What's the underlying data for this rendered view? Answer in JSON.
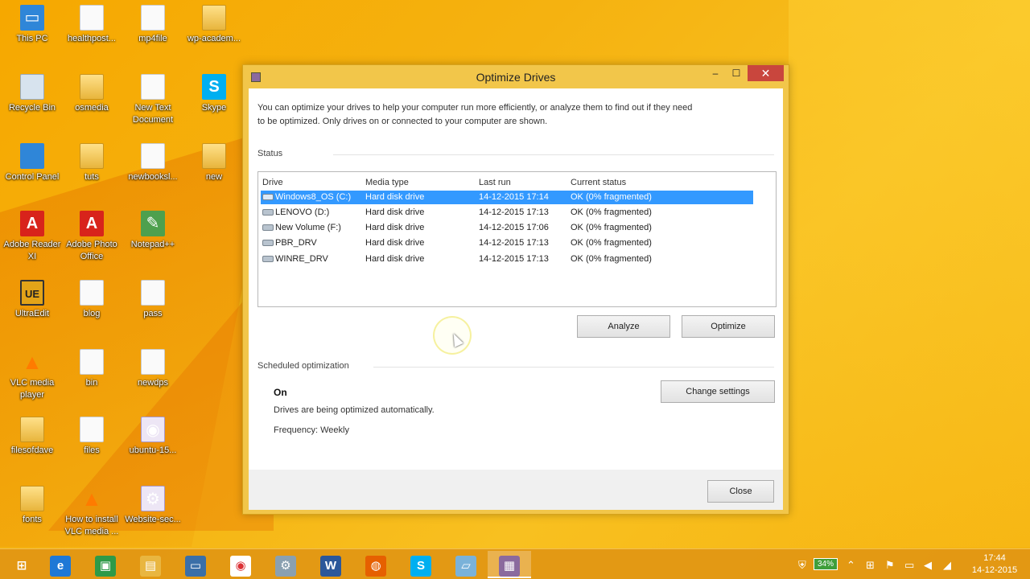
{
  "desktop": {
    "icons": [
      {
        "label": "This PC",
        "glyph": "▭",
        "kind": "pc"
      },
      {
        "label": "healthpost...",
        "glyph": "",
        "kind": "doc"
      },
      {
        "label": "mp4file",
        "glyph": "",
        "kind": "doc"
      },
      {
        "label": "wp-academ...",
        "glyph": "",
        "kind": "folder"
      },
      {
        "label": "Recycle Bin",
        "glyph": "",
        "kind": "bin"
      },
      {
        "label": "osmedia",
        "glyph": "",
        "kind": "folder"
      },
      {
        "label": "New Text Document",
        "glyph": "",
        "kind": "doc"
      },
      {
        "label": "Skype",
        "glyph": "S",
        "kind": "skype"
      },
      {
        "label": "Control Panel",
        "glyph": "",
        "kind": "pc"
      },
      {
        "label": "tuts",
        "glyph": "",
        "kind": "folder"
      },
      {
        "label": "newbooksl...",
        "glyph": "",
        "kind": "doc"
      },
      {
        "label": "new",
        "glyph": "",
        "kind": "folder"
      },
      {
        "label": "Adobe Reader XI",
        "glyph": "A",
        "kind": "red"
      },
      {
        "label": "Adobe Photo Office",
        "glyph": "A",
        "kind": "red"
      },
      {
        "label": "Notepad++",
        "glyph": "✎",
        "kind": "green"
      },
      {
        "label": "UltraEdit",
        "glyph": "UE",
        "kind": "ue"
      },
      {
        "label": "blog",
        "glyph": "",
        "kind": "doc"
      },
      {
        "label": "pass",
        "glyph": "",
        "kind": "doc"
      },
      {
        "label": "VLC media player",
        "glyph": "▲",
        "kind": "vlc"
      },
      {
        "label": "bin",
        "glyph": "",
        "kind": "doc"
      },
      {
        "label": "newdps",
        "glyph": "",
        "kind": "doc"
      },
      {
        "label": "filesofdave",
        "glyph": "",
        "kind": "folder"
      },
      {
        "label": "files",
        "glyph": "",
        "kind": "doc"
      },
      {
        "label": "ubuntu-15...",
        "glyph": "◉",
        "kind": "disc"
      },
      {
        "label": "fonts",
        "glyph": "",
        "kind": "folder"
      },
      {
        "label": "How to install VLC media ...",
        "glyph": "▲",
        "kind": "vlc"
      },
      {
        "label": "Website-sec...",
        "glyph": "⚙",
        "kind": "disc"
      }
    ]
  },
  "window": {
    "title": "Optimize Drives",
    "controls": {
      "minimize": "–",
      "maximize": "☐",
      "close": "✕"
    },
    "intro_line1": "You can optimize your drives to help your computer run more efficiently, or analyze them to find out if they need",
    "intro_line2": "to be optimized. Only drives on or connected to your computer are shown.",
    "status_label": "Status",
    "columns": {
      "drive": "Drive",
      "media_type": "Media type",
      "last_run": "Last run",
      "current_status": "Current status"
    },
    "drives": [
      {
        "drive": "Windows8_OS (C:)",
        "media_type": "Hard disk drive",
        "last_run": "14-12-2015 17:14",
        "status": "OK (0% fragmented)",
        "selected": true
      },
      {
        "drive": "LENOVO (D:)",
        "media_type": "Hard disk drive",
        "last_run": "14-12-2015 17:13",
        "status": "OK (0% fragmented)",
        "selected": false
      },
      {
        "drive": "New Volume (F:)",
        "media_type": "Hard disk drive",
        "last_run": "14-12-2015 17:06",
        "status": "OK (0% fragmented)",
        "selected": false
      },
      {
        "drive": "PBR_DRV",
        "media_type": "Hard disk drive",
        "last_run": "14-12-2015 17:13",
        "status": "OK (0% fragmented)",
        "selected": false
      },
      {
        "drive": "WINRE_DRV",
        "media_type": "Hard disk drive",
        "last_run": "14-12-2015 17:13",
        "status": "OK (0% fragmented)",
        "selected": false
      }
    ],
    "analyze_label": "Analyze",
    "optimize_label": "Optimize",
    "scheduled_label": "Scheduled optimization",
    "schedule_state": "On",
    "schedule_desc": "Drives are being optimized automatically.",
    "schedule_frequency": "Frequency: Weekly",
    "change_settings_label": "Change settings",
    "close_label": "Close"
  },
  "taskbar": {
    "items": [
      {
        "name": "start",
        "glyph": "⊞"
      },
      {
        "name": "internet-explorer",
        "glyph": "e"
      },
      {
        "name": "store",
        "glyph": "▣"
      },
      {
        "name": "file-explorer",
        "glyph": "▤"
      },
      {
        "name": "remote-desktop",
        "glyph": "▭"
      },
      {
        "name": "chrome",
        "glyph": "◉"
      },
      {
        "name": "settings",
        "glyph": "⚙"
      },
      {
        "name": "word",
        "glyph": "W"
      },
      {
        "name": "firefox",
        "glyph": "◍"
      },
      {
        "name": "skype",
        "glyph": "S"
      },
      {
        "name": "notepad",
        "glyph": "▱"
      },
      {
        "name": "optimize-drives",
        "glyph": "▦"
      }
    ],
    "battery": "34%",
    "time": "17:44",
    "date": "14-12-2015"
  },
  "colors": {
    "accent": "#3399ff",
    "wallpaper": "#f6a800",
    "close": "#c9463d"
  }
}
